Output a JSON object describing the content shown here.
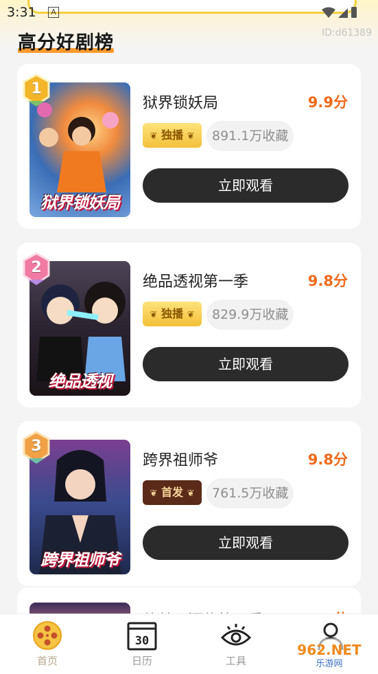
{
  "status_bar": {
    "time": "3:31",
    "notification_letter": "A"
  },
  "header": {
    "title": "高分好剧榜",
    "user_id": "ID:d61389"
  },
  "rankings": [
    {
      "rank": "1",
      "title": "狱界锁妖局",
      "score": "9.9分",
      "tag": "独播",
      "favorites": "891.1万收藏",
      "button": "立即观看",
      "poster_caption": "狱界锁妖局"
    },
    {
      "rank": "2",
      "title": "绝品透视第一季",
      "score": "9.8分",
      "tag": "独播",
      "favorites": "829.9万收藏",
      "button": "立即观看",
      "poster_caption": "绝品透视"
    },
    {
      "rank": "3",
      "title": "跨界祖师爷",
      "score": "9.8分",
      "tag": "首发",
      "favorites": "761.5万收藏",
      "button": "立即观看",
      "poster_caption": "跨界祖师爷"
    }
  ],
  "partial_item": {
    "title": "仙羊三河传第一季",
    "score": "分"
  },
  "bottom_nav": [
    {
      "label": "首页",
      "icon": "film-reel-icon",
      "active": true
    },
    {
      "label": "日历",
      "icon": "calendar-icon",
      "active": false
    },
    {
      "label": "工具",
      "icon": "eye-icon",
      "active": false
    },
    {
      "label": "我的",
      "icon": "person-icon",
      "active": false
    }
  ],
  "calendar_icon_text": "30",
  "watermark": {
    "text": "962.NET",
    "subtext": "乐游网"
  },
  "colors": {
    "accent": "#ef6a1b",
    "button": "#2b2b2b",
    "gold_tag": "#f3c03a",
    "dark_tag": "#5b2a19"
  }
}
